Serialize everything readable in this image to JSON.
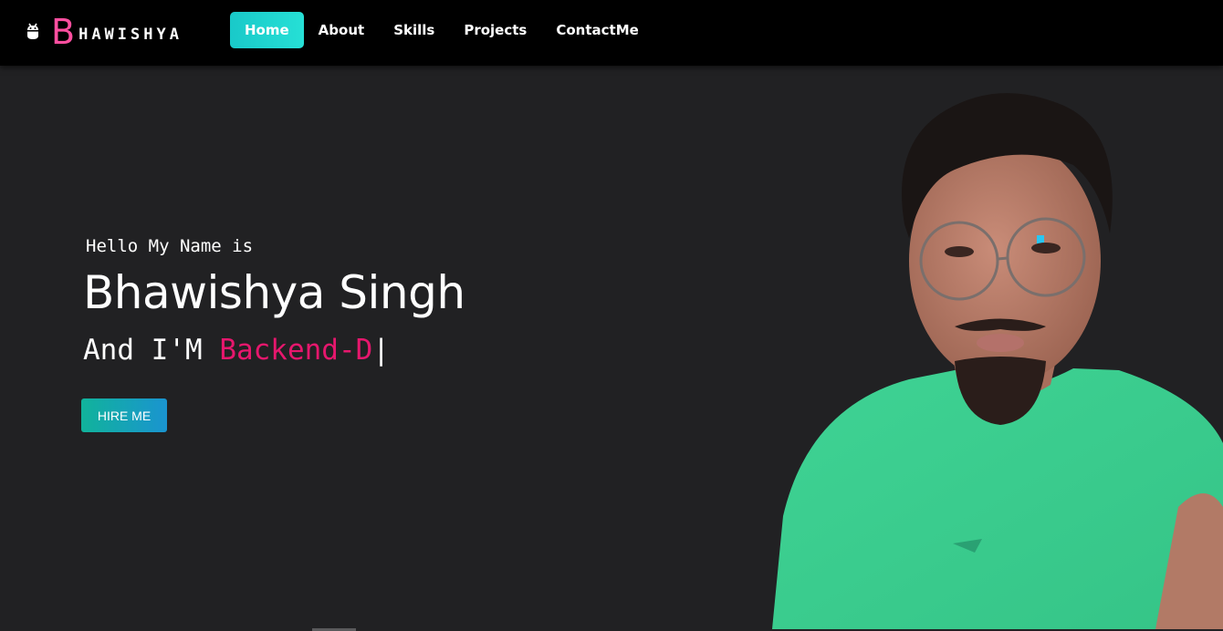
{
  "brand": {
    "icon": "robot-icon",
    "initial": "B",
    "rest": "HAWISHYA",
    "accent_color": "#ff4fa0"
  },
  "nav": {
    "items": [
      {
        "label": "Home",
        "active": true
      },
      {
        "label": "About",
        "active": false
      },
      {
        "label": "Skills",
        "active": false
      },
      {
        "label": "Projects",
        "active": false
      },
      {
        "label": "ContactMe",
        "active": false
      }
    ],
    "active_color": "#1fd6d0"
  },
  "hero": {
    "greeting": "Hello My Name is",
    "name": "Bhawishya Singh",
    "role_prefix": "And I'M ",
    "role_typed": "Backend-D",
    "cursor": "|",
    "typed_color": "#e6176d",
    "cta_label": "HIRE ME"
  },
  "colors": {
    "background": "#212123",
    "navbar": "#000000",
    "shirt": "#3fd394"
  }
}
